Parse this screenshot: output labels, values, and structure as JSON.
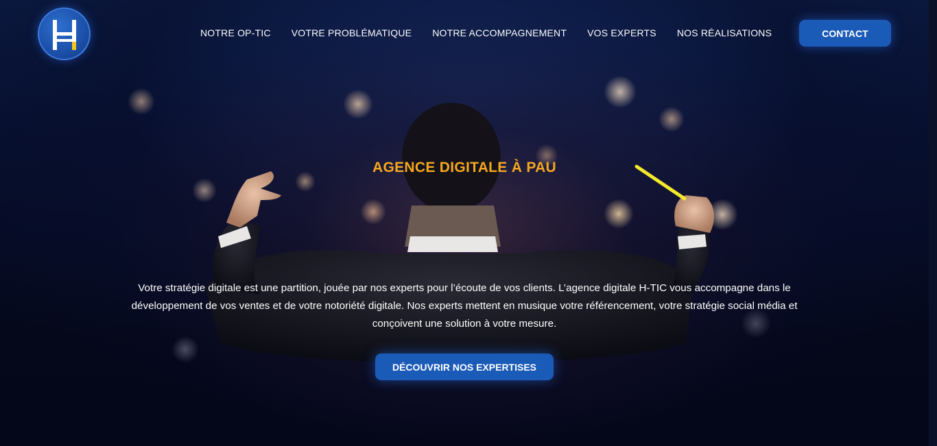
{
  "header": {
    "logo_alt": "H-TIC",
    "nav": [
      {
        "label": "NOTRE OP-TIC"
      },
      {
        "label": "VOTRE PROBLÉMATIQUE"
      },
      {
        "label": "NOTRE ACCOMPAGNEMENT"
      },
      {
        "label": "VOS EXPERTS"
      },
      {
        "label": "NOS RÉALISATIONS"
      }
    ],
    "contact_label": "CONTACT"
  },
  "hero": {
    "title": "AGENCE DIGITALE À PAU",
    "text": "Votre stratégie digitale est une partition, jouée par nos experts pour l’écoute de vos clients. L’agence digitale H-TIC vous accompagne dans le développement de vos ventes et de votre notoriété digitale. Nos experts mettent en musique votre référencement, votre stratégie social média et conçoivent une solution à votre mesure.",
    "cta_label": "DÉCOUVRIR NOS EXPERTISES"
  },
  "colors": {
    "accent": "#f5a81e",
    "button": "#1b5bb8",
    "background": "#05081a"
  }
}
